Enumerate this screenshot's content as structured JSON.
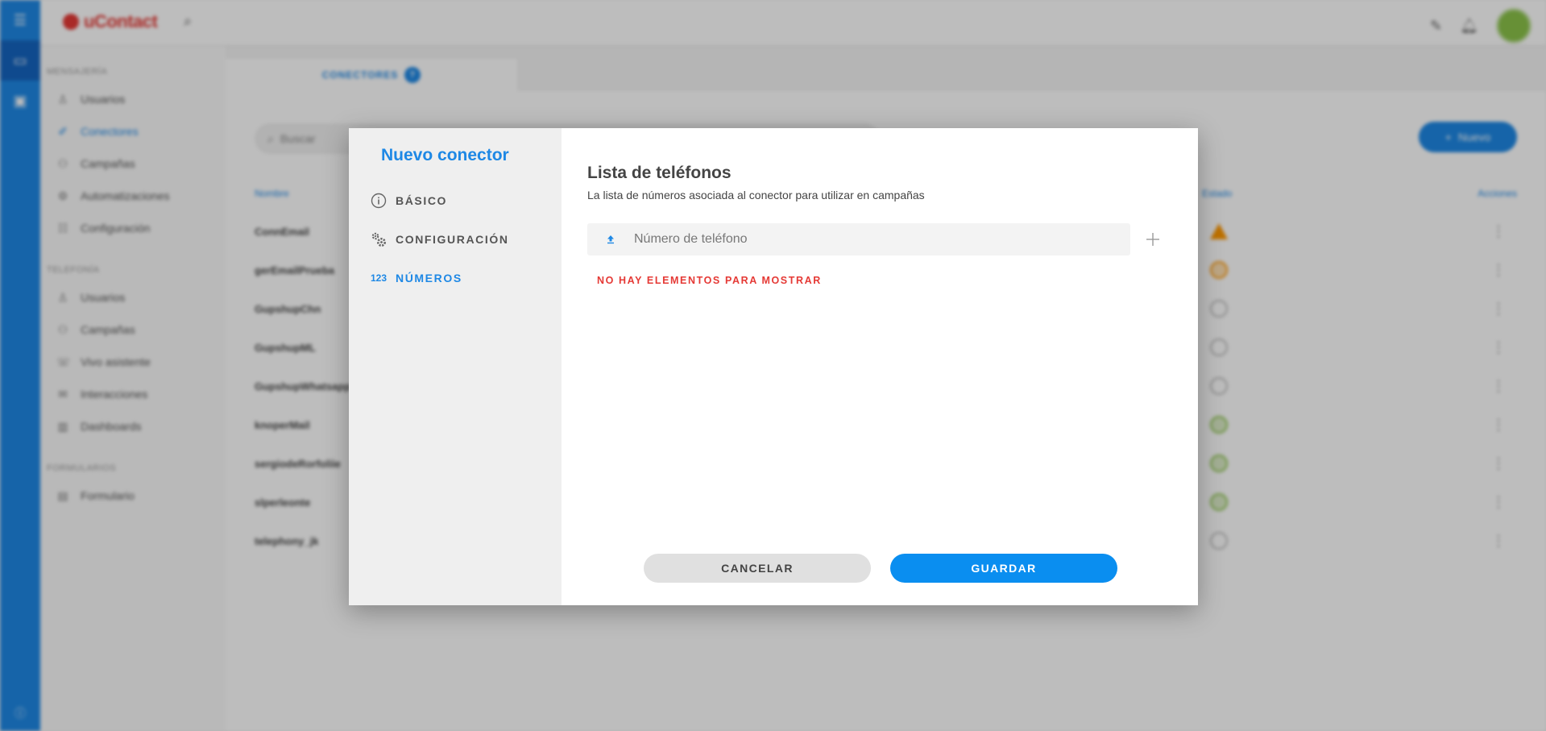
{
  "modal": {
    "title": "Nuevo conector",
    "nav": [
      {
        "label": "BÁSICO",
        "icon": "info-icon",
        "active": false
      },
      {
        "label": "CONFIGURACIÓN",
        "icon": "gears-icon",
        "active": false
      },
      {
        "label": "NÚMEROS",
        "icon": "numbers-123-icon",
        "icon_text": "123",
        "active": true
      }
    ],
    "section_title": "Lista de teléfonos",
    "section_description": "La lista de números asociada al conector para utilizar en campañas",
    "phone_input": {
      "placeholder": "Número de teléfono",
      "value": ""
    },
    "empty_message": "NO HAY ELEMENTOS PARA MOSTRAR",
    "cancel_label": "CANCELAR",
    "save_label": "GUARDAR"
  },
  "colors": {
    "accent": "#1e88e5",
    "save_button": "#0a8ef0",
    "empty_message": "#e53935",
    "overlay": "rgba(0,0,0,0.26)"
  },
  "background": {
    "brand": "uContact",
    "tab_label": "CONECTORES",
    "search_placeholder": "Buscar",
    "new_button_label": "Nuevo",
    "table_headers": {
      "name": "Nombre",
      "state": "Estado",
      "actions": "Acciones"
    },
    "sidebar": {
      "section_1": "MENSAJERÍA",
      "items_1": [
        "Usuarios",
        "Conectores",
        "Campañas",
        "Automatizaciones",
        "Configuración"
      ],
      "section_2": "TELEFONÍA",
      "items_2": [
        "Usuarios",
        "Campañas",
        "Vivo asistente",
        "Interacciones",
        "Dashboards"
      ],
      "section_3": "FORMULARIOS",
      "items_3": [
        "Formulario"
      ]
    },
    "rows": [
      {
        "name": "ConnEmail",
        "status": "warning"
      },
      {
        "name": "gerEmailPrueba",
        "status": "orange"
      },
      {
        "name": "GupshupChn",
        "status": "inactive"
      },
      {
        "name": "GupshupML",
        "status": "inactive"
      },
      {
        "name": "GupshupWhatsapp",
        "status": "inactive"
      },
      {
        "name": "knoperMail",
        "status": "active"
      },
      {
        "name": "sergiodeRorfoliie",
        "status": "active"
      },
      {
        "name": "slperleonte",
        "status": "active"
      },
      {
        "name": "telephony_jk",
        "status": "inactive"
      }
    ]
  }
}
